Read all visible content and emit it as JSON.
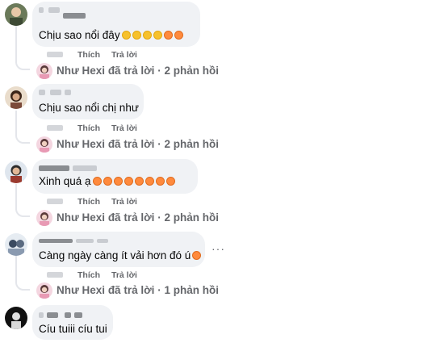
{
  "comments": [
    {
      "author": "",
      "text": "Chịu sao nổi đây",
      "emojis": [
        "smile",
        "smile",
        "smile",
        "tongue",
        "rofl",
        "rofl"
      ],
      "actions": {
        "like": "Thích",
        "reply": "Trả lời"
      },
      "reply_summary": {
        "who": "Như Hexi",
        "verb": "đã trả lời",
        "sep": "·",
        "count": "2 phản hồi"
      }
    },
    {
      "author": "",
      "text": "Chịu sao nổi chị như",
      "emojis": [],
      "actions": {
        "like": "Thích",
        "reply": "Trả lời"
      },
      "reply_summary": {
        "who": "Như Hexi",
        "verb": "đã trả lời",
        "sep": "·",
        "count": "2 phản hồi"
      }
    },
    {
      "author": "",
      "text": "Xinh quá ạ",
      "emojis": [
        "love",
        "love",
        "love",
        "love",
        "love",
        "love",
        "love",
        "love"
      ],
      "actions": {
        "like": "Thích",
        "reply": "Trả lời"
      },
      "reply_summary": {
        "who": "Như Hexi",
        "verb": "đã trả lời",
        "sep": "·",
        "count": "2 phản hồi"
      }
    },
    {
      "author": "",
      "text": "Càng ngày càng ít vải hơn đó ú",
      "emojis": [
        "rofl"
      ],
      "actions": {
        "like": "Thích",
        "reply": "Trả lời"
      },
      "more": "···",
      "reply_summary": {
        "who": "Như Hexi",
        "verb": "đã trả lời",
        "sep": "·",
        "count": "1 phản hồi"
      }
    },
    {
      "author": "",
      "text": "Cíu tuiii cíu tui",
      "emojis": []
    }
  ],
  "colors": {
    "bubble": "#f0f2f5",
    "meta": "#65676b",
    "text": "#050505",
    "thread_line": "#e4e6eb"
  }
}
